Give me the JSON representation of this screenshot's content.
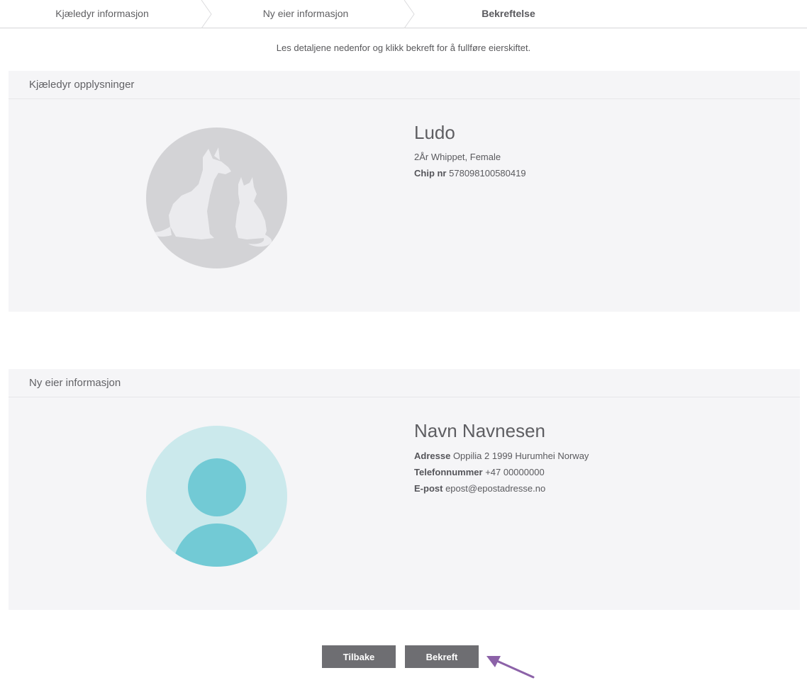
{
  "steps": [
    {
      "label": "Kjæledyr informasjon",
      "active": false
    },
    {
      "label": "Ny eier informasjon",
      "active": false
    },
    {
      "label": "Bekreftelse",
      "active": true
    }
  ],
  "intro": "Les detaljene nedenfor og klikk bekreft for å fullføre eierskiftet.",
  "pet_panel": {
    "title": "Kjæledyr opplysninger",
    "name": "Ludo",
    "description": "2År Whippet, Female",
    "chip_label": "Chip nr",
    "chip_value": "578098100580419"
  },
  "owner_panel": {
    "title": "Ny eier informasjon",
    "name": "Navn Navnesen",
    "address_label": "Adresse",
    "address_value": "Oppilia 2 1999 Hurumhei Norway",
    "phone_label": "Telefonnummer",
    "phone_value": "+47 00000000",
    "email_label": "E-post",
    "email_value": "epost@epostadresse.no"
  },
  "buttons": {
    "back": "Tilbake",
    "confirm": "Bekreft"
  },
  "colors": {
    "button_bg": "#6e6e72",
    "panel_bg": "#f5f5f7",
    "owner_avatar_bg": "#cbe9ec",
    "owner_avatar_fg": "#72cad5",
    "pet_avatar_bg": "#d3d3d6",
    "annotation_arrow": "#8c62a8"
  },
  "icons": {
    "pet_avatar": "dog-cat-silhouette-icon",
    "owner_avatar": "person-silhouette-icon",
    "step_separator": "chevron-right-icon",
    "annotation": "arrow-pointer-icon"
  }
}
